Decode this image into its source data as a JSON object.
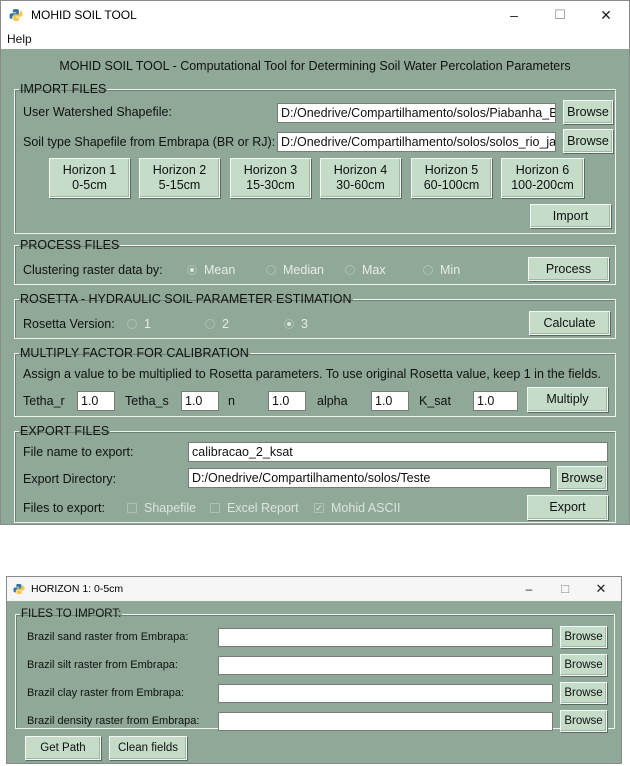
{
  "main": {
    "title": "MOHID SOIL TOOL",
    "menu": [
      "Help"
    ],
    "heading": "MOHID SOIL TOOL - Computational Tool for Determining Soil Water Percolation Parameters",
    "import": {
      "legend": "IMPORT FILES",
      "watershed_label": "User Watershed Shapefile:",
      "watershed_value": "D:/Onedrive/Compartilhamento/solos/Piabanha_Bac",
      "soil_label": "Soil type Shapefile from Embrapa (BR or RJ):",
      "soil_value": "D:/Onedrive/Compartilhamento/solos/solos_rio_jane",
      "browse": "Browse",
      "horizons": [
        {
          "name": "Horizon 1",
          "depth": "0-5cm"
        },
        {
          "name": "Horizon 2",
          "depth": "5-15cm"
        },
        {
          "name": "Horizon 3",
          "depth": "15-30cm"
        },
        {
          "name": "Horizon 4",
          "depth": "30-60cm"
        },
        {
          "name": "Horizon 5",
          "depth": "60-100cm"
        },
        {
          "name": "Horizon 6",
          "depth": "100-200cm"
        }
      ],
      "import_btn": "Import"
    },
    "process": {
      "legend": "PROCESS FILES",
      "label": "Clustering raster data by:",
      "options": [
        "Mean",
        "Median",
        "Max",
        "Min"
      ],
      "selected": "Mean",
      "button": "Process"
    },
    "rosetta": {
      "legend": "ROSETTA - HYDRAULIC SOIL PARAMETER ESTIMATION",
      "label": "Rosetta Version:",
      "options": [
        "1",
        "2",
        "3"
      ],
      "selected": "3",
      "button": "Calculate"
    },
    "multiply": {
      "legend": "MULTIPLY FACTOR FOR CALIBRATION",
      "instruction": "Assign a value to be multiplied to Rosetta parameters. To use original Rosetta value, keep 1 in the fields.",
      "params": [
        {
          "name": "Tetha_r",
          "value": "1.0"
        },
        {
          "name": "Tetha_s",
          "value": "1.0"
        },
        {
          "name": "n",
          "value": "1.0"
        },
        {
          "name": "alpha",
          "value": "1.0"
        },
        {
          "name": "K_sat",
          "value": "1.0"
        }
      ],
      "button": "Multiply"
    },
    "export": {
      "legend": "EXPORT FILES",
      "file_label": "File name to export:",
      "file_value": "calibracao_2_ksat",
      "dir_label": "Export Directory:",
      "dir_value": "D:/Onedrive/Compartilhamento/solos/Teste",
      "browse": "Browse",
      "files_label": "Files to export:",
      "options": [
        {
          "label": "Shapefile",
          "checked": false
        },
        {
          "label": "Excel Report",
          "checked": false
        },
        {
          "label": "Mohid ASCII",
          "checked": true
        }
      ],
      "button": "Export"
    }
  },
  "horizon_window": {
    "title": "HORIZON 1: 0-5cm",
    "legend": "FILES TO IMPORT:",
    "rows": [
      {
        "label": "Brazil sand raster from Embrapa:",
        "value": ""
      },
      {
        "label": "Brazil silt raster from Embrapa:",
        "value": ""
      },
      {
        "label": "Brazil clay raster from Embrapa:",
        "value": ""
      },
      {
        "label": "Brazil density raster from Embrapa:",
        "value": ""
      }
    ],
    "browse": "Browse",
    "get_path": "Get Path",
    "clean_fields": "Clean fields"
  },
  "window_controls": {
    "minimize": "–",
    "maximize": "☐",
    "close": "✕"
  }
}
